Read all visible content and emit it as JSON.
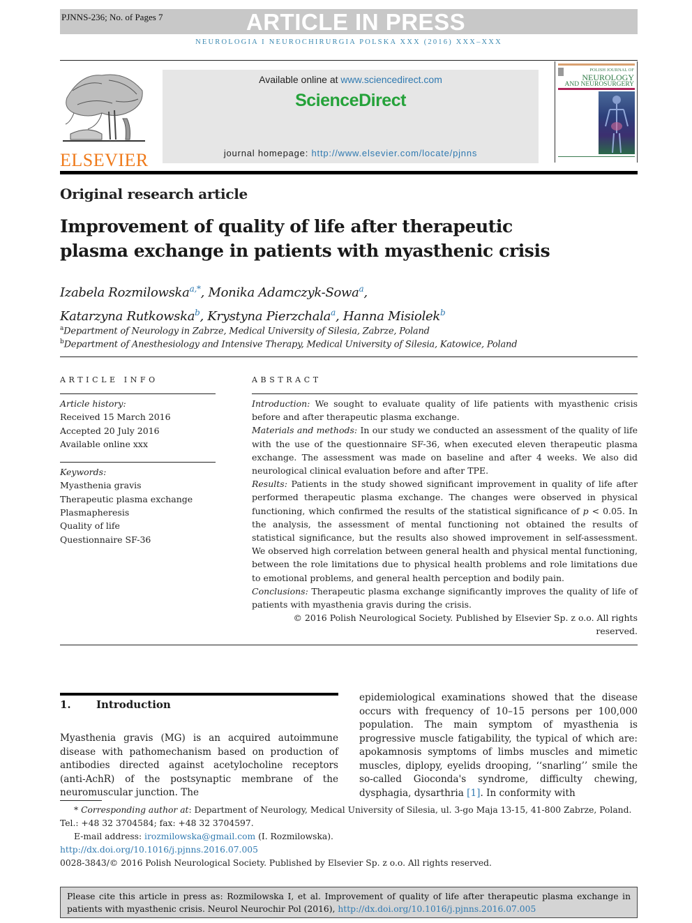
{
  "banner": {
    "manuscript_ref": "PJNNS-236; No. of Pages 7",
    "status": "ARTICLE IN PRESS",
    "running_header": "NEUROLOGIA I NEUROCHIRURGIA POLSKA XXX (2016) XXX–XXX"
  },
  "header": {
    "publisher_logo_text": "ELSEVIER",
    "available_prefix": "Available online at ",
    "available_link": "www.sciencedirect.com",
    "brand": "ScienceDirect",
    "homepage_prefix": "journal homepage: ",
    "homepage_link": "http://www.elsevier.com/locate/pjnns",
    "cover": {
      "line1": "POLISH JOURNAL OF",
      "line2": "NEUROLOGY",
      "line3": "AND NEUROSURGERY"
    }
  },
  "article": {
    "type": "Original research article",
    "title_line1": "Improvement of quality of life after therapeutic",
    "title_line2": "plasma exchange in patients with myasthenic crisis",
    "authors": [
      {
        "name": "Izabela Rozmilowska",
        "sup": "a,*",
        "sep": ", "
      },
      {
        "name": "Monika Adamczyk-Sowa",
        "sup": "a",
        "sep": ","
      },
      {
        "name": "Katarzyna Rutkowska",
        "sup": "b",
        "sep": ", "
      },
      {
        "name": "Krystyna Pierzchala",
        "sup": "a",
        "sep": ", "
      },
      {
        "name": "Hanna Misiolek",
        "sup": "b",
        "sep": ""
      }
    ],
    "affiliations": [
      {
        "key": "a",
        "text": "Department of Neurology in Zabrze, Medical University of Silesia, Zabrze, Poland"
      },
      {
        "key": "b",
        "text": "Department of Anesthesiology and Intensive Therapy, Medical University of Silesia, Katowice, Poland"
      }
    ]
  },
  "article_info": {
    "heading": "ARTICLE INFO",
    "history_label": "Article history:",
    "history": [
      "Received 15 March 2016",
      "Accepted 20 July 2016",
      "Available online xxx"
    ],
    "keywords_label": "Keywords:",
    "keywords": [
      "Myasthenia gravis",
      "Therapeutic plasma exchange",
      "Plasmapheresis",
      "Quality of life",
      "Questionnaire SF-36"
    ]
  },
  "abstract": {
    "heading": "ABSTRACT",
    "intro_label": "Introduction:",
    "intro_text": " We sought to evaluate quality of life patients with myasthenic crisis before and after therapeutic plasma exchange.",
    "methods_label": "Materials and methods:",
    "methods_text": " In our study we conducted an assessment of the quality of life with the use of the questionnaire SF-36, when executed eleven therapeutic plasma exchange. The assessment was made on baseline and after 4 weeks. We also did neurological clinical evaluation before and after TPE.",
    "results_label": "Results:",
    "results_text_1": " Patients in the study showed significant improvement in quality of life after performed therapeutic plasma exchange. The changes were observed in physical functioning, which confirmed the results of the statistical significance of ",
    "results_p": "p",
    "results_text_2": " < 0.05. In the analysis, the assessment of mental functioning not obtained the results of statistical significance, but the results also showed improvement in self-assessment. We observed high correlation between general health and physical mental functioning, between the role limitations due to physical health problems and role limitations due to emotional problems, and general health perception and bodily pain.",
    "conclusions_label": "Conclusions:",
    "conclusions_text": " Therapeutic plasma exchange significantly improves the quality of life of patients with myasthenia gravis during the crisis.",
    "copyright": "© 2016 Polish Neurological Society. Published by Elsevier Sp. z o.o. All rights reserved."
  },
  "body": {
    "section_number": "1.",
    "section_title": "Introduction",
    "col1": "Myasthenia gravis (MG) is an acquired autoimmune disease with pathomechanism based on production of antibodies directed against acetylocholine receptors (anti-AchR) of the postsynaptic membrane of the neuromuscular junction. The",
    "col2_before": "epidemiological examinations showed that the disease occurs with frequency of 10–15 persons per 100,000 population. The main symptom of myasthenia is progressive muscle fatigability, the typical of which are: apokamnosis symptoms of limbs muscles and mimetic muscles, diplopy, eyelids drooping, ‘‘snarling’’ smile the so-called Gioconda's syndrome, difficulty chewing, dysphagia, dysarthria ",
    "col2_ref": "[1]",
    "col2_after": ". In conformity with"
  },
  "footnotes": {
    "corr_label": "Corresponding author at",
    "corr_text": ": Department of Neurology, Medical University of Silesia, ul. 3-go Maja 13-15, 41-800 Zabrze, Poland.",
    "tel": "Tel.: +48 32 3704584; fax: +48 32 3704597.",
    "email_prefix": "E-mail address: ",
    "email": "irozmilowska@gmail.com",
    "email_suffix": " (I. Rozmilowska).",
    "doi": "http://dx.doi.org/10.1016/j.pjnns.2016.07.005",
    "issn_line": "0028-3843/© 2016 Polish Neurological Society. Published by Elsevier Sp. z o.o. All rights reserved."
  },
  "citation": {
    "text": "Please cite this article in press as: Rozmilowska I, et al. Improvement of quality of life after therapeutic plasma exchange in patients with myasthenic crisis. Neurol Neurochir Pol (2016), ",
    "link": "http://dx.doi.org/10.1016/j.pjnns.2016.07.005"
  }
}
